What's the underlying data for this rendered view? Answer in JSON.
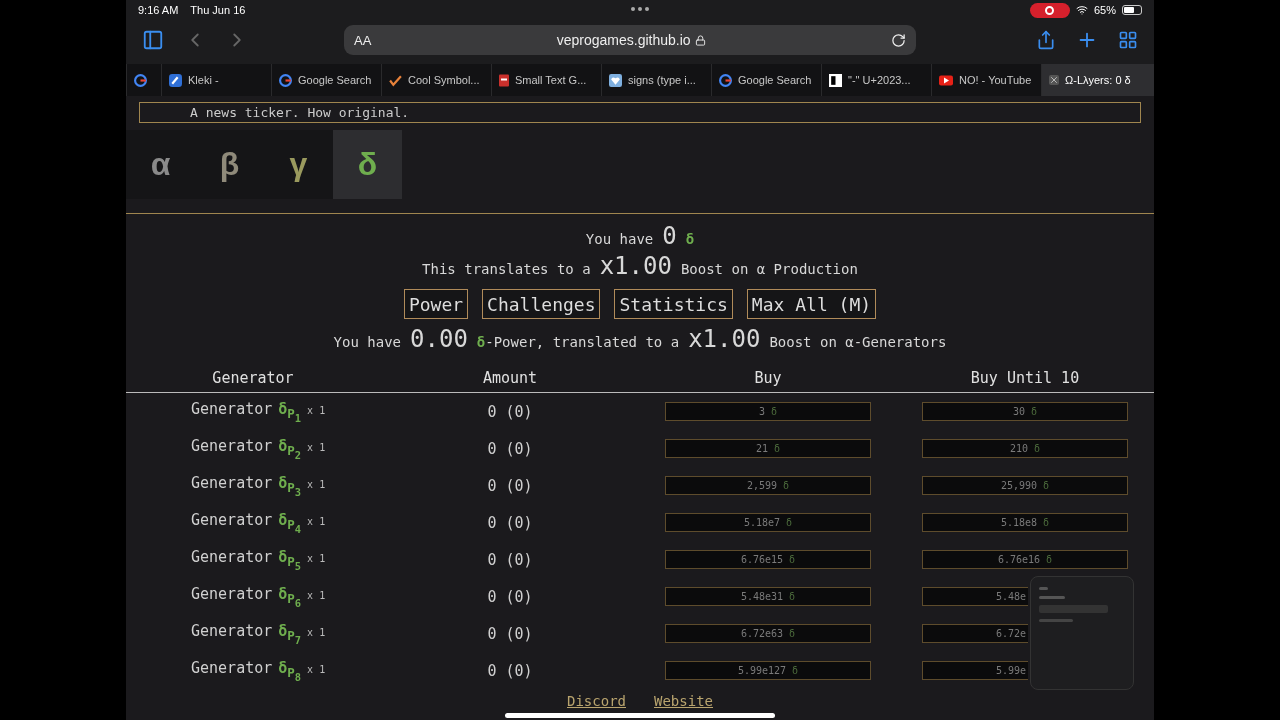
{
  "status_bar": {
    "time": "9:16 AM",
    "date": "Thu Jun 16",
    "battery": "65%"
  },
  "toolbar": {
    "text_size": "AA",
    "url": "veprogames.github.io"
  },
  "tabs": [
    {
      "kind": "google",
      "selected": false
    },
    {
      "kind": "kleki",
      "label": "Kleki -",
      "selected": false
    },
    {
      "kind": "google",
      "label": "Google Search",
      "selected": false
    },
    {
      "kind": "check",
      "label": "Cool Symbol...",
      "selected": false
    },
    {
      "kind": "doc",
      "label": "Small Text G...",
      "selected": false
    },
    {
      "kind": "heart",
      "label": "signs (type i...",
      "selected": false
    },
    {
      "kind": "google",
      "label": "Google Search",
      "selected": false
    },
    {
      "kind": "glyph",
      "label": "\"-\" U+2023...",
      "selected": false
    },
    {
      "kind": "youtube",
      "label": "NO! - YouTube",
      "selected": false
    },
    {
      "kind": "close",
      "label": "Ω-Lλyers: 0 δ",
      "selected": true
    }
  ],
  "news_ticker": "A news ticker. How original.",
  "layer_tabs": [
    {
      "symbol": "α",
      "color": "#8a8a8a",
      "selected": false
    },
    {
      "symbol": "β",
      "color": "#8f8a7a",
      "selected": false
    },
    {
      "symbol": "γ",
      "color": "#9a9a5e",
      "selected": false
    },
    {
      "symbol": "δ",
      "color": "#6fae4e",
      "selected": true
    }
  ],
  "summary_lines": [
    [
      {
        "kind": "plain",
        "text": "You have"
      },
      {
        "kind": "big",
        "text": "0"
      },
      {
        "kind": "symbol",
        "text": "δ"
      }
    ],
    [
      {
        "kind": "plain",
        "text": "This translates to a"
      },
      {
        "kind": "big",
        "text": "x1.00"
      },
      {
        "kind": "plain",
        "text": "Boost on α Production"
      }
    ]
  ],
  "buttons": [
    "Power",
    "Challenges",
    "Statistics",
    "Max All (M)"
  ],
  "power_line": [
    {
      "kind": "plain",
      "text": "You have"
    },
    {
      "kind": "big",
      "text": "0.00"
    },
    {
      "kind": "symbol",
      "text": "δ"
    },
    {
      "kind": "plain",
      "text": "-Power, translated to a"
    },
    {
      "kind": "big",
      "text": "x1.00"
    },
    {
      "kind": "plain",
      "text": "Boost on α-Generators"
    }
  ],
  "table": {
    "columns": [
      "Generator",
      "Amount",
      "Buy",
      "Buy Until 10"
    ],
    "rows": [
      {
        "name": "Generator",
        "symbol": "δ",
        "sub": "P",
        "index": "1",
        "multiplier": "x 1",
        "amount": "0 (0)",
        "buy": {
          "cost": "3",
          "symbol": "δ"
        },
        "buy_until": {
          "cost": "30",
          "symbol": "δ",
          "covered": false
        }
      },
      {
        "name": "Generator",
        "symbol": "δ",
        "sub": "P",
        "index": "2",
        "multiplier": "x 1",
        "amount": "0 (0)",
        "buy": {
          "cost": "21",
          "symbol": "δ"
        },
        "buy_until": {
          "cost": "210",
          "symbol": "δ",
          "covered": false
        }
      },
      {
        "name": "Generator",
        "symbol": "δ",
        "sub": "P",
        "index": "3",
        "multiplier": "x 1",
        "amount": "0 (0)",
        "buy": {
          "cost": "2,599",
          "symbol": "δ"
        },
        "buy_until": {
          "cost": "25,990",
          "symbol": "δ",
          "covered": false
        }
      },
      {
        "name": "Generator",
        "symbol": "δ",
        "sub": "P",
        "index": "4",
        "multiplier": "x 1",
        "amount": "0 (0)",
        "buy": {
          "cost": "5.18e7",
          "symbol": "δ"
        },
        "buy_until": {
          "cost": "5.18e8",
          "symbol": "δ",
          "covered": false
        }
      },
      {
        "name": "Generator",
        "symbol": "δ",
        "sub": "P",
        "index": "5",
        "multiplier": "x 1",
        "amount": "0 (0)",
        "buy": {
          "cost": "6.76e15",
          "symbol": "δ"
        },
        "buy_until": {
          "cost": "6.76e16",
          "symbol": "δ",
          "covered": false
        }
      },
      {
        "name": "Generator",
        "symbol": "δ",
        "sub": "P",
        "index": "6",
        "multiplier": "x 1",
        "amount": "0 (0)",
        "buy": {
          "cost": "5.48e31",
          "symbol": "δ"
        },
        "buy_until": {
          "cost": "5.48e",
          "covered": true
        }
      },
      {
        "name": "Generator",
        "symbol": "δ",
        "sub": "P",
        "index": "7",
        "multiplier": "x 1",
        "amount": "0 (0)",
        "buy": {
          "cost": "6.72e63",
          "symbol": "δ"
        },
        "buy_until": {
          "cost": "6.72e",
          "covered": true
        }
      },
      {
        "name": "Generator",
        "symbol": "δ",
        "sub": "P",
        "index": "8",
        "multiplier": "x 1",
        "amount": "0 (0)",
        "buy": {
          "cost": "5.99e127",
          "symbol": "δ"
        },
        "buy_until": {
          "cost": "5.99e",
          "covered": true
        }
      }
    ]
  },
  "footer_links": [
    "Discord",
    "Website"
  ]
}
